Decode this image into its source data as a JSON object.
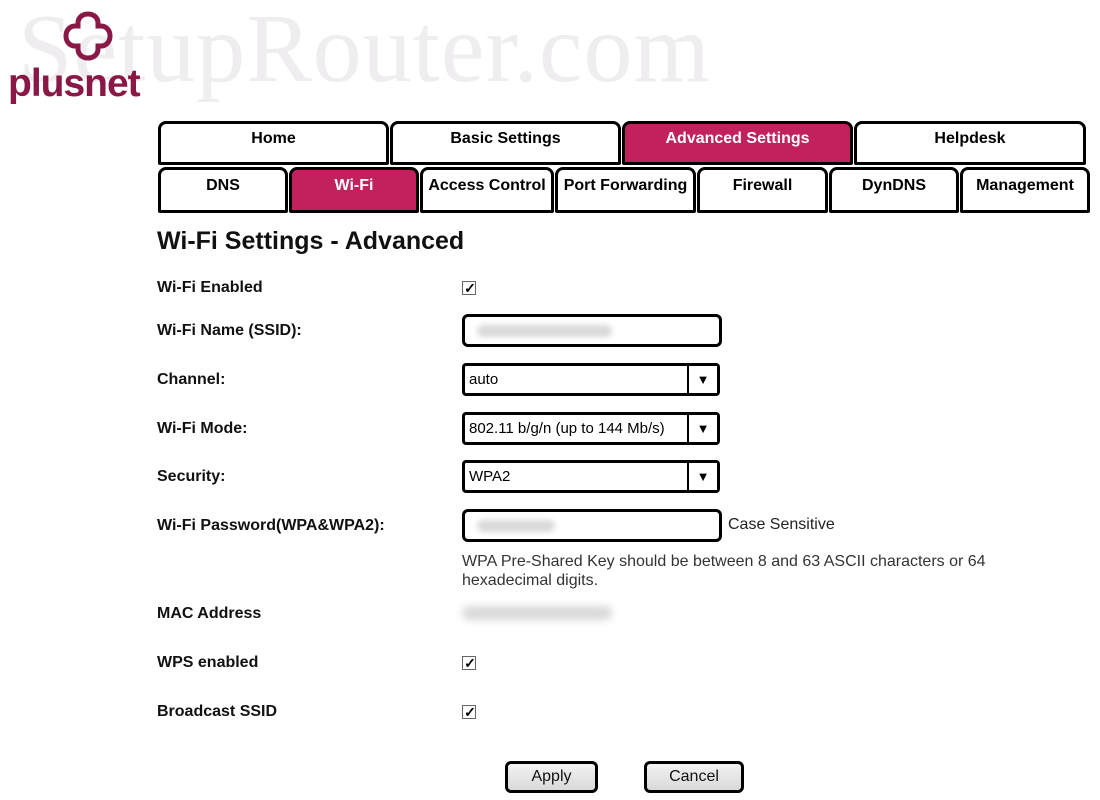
{
  "branding": {
    "logo_text": "plusnet",
    "watermark": "SetupRouter.com",
    "brand_color": "#c1225e",
    "logo_color": "#8a1846"
  },
  "main_tabs": [
    {
      "label": "Home",
      "active": false
    },
    {
      "label": "Basic Settings",
      "active": false
    },
    {
      "label": "Advanced Settings",
      "active": true
    },
    {
      "label": "Helpdesk",
      "active": false
    }
  ],
  "sub_tabs": [
    {
      "label": "DNS",
      "active": false
    },
    {
      "label": "Wi-Fi",
      "active": true
    },
    {
      "label": "Access Control",
      "active": false
    },
    {
      "label": "Port Forwarding",
      "active": false
    },
    {
      "label": "Firewall",
      "active": false
    },
    {
      "label": "DynDNS",
      "active": false
    },
    {
      "label": "Management",
      "active": false
    }
  ],
  "page_title": "Wi-Fi Settings - Advanced",
  "form": {
    "wifi_enabled": {
      "label": "Wi-Fi Enabled",
      "checked": true
    },
    "ssid": {
      "label": "Wi-Fi Name (SSID):",
      "value_redacted": true
    },
    "channel": {
      "label": "Channel:",
      "value": "auto"
    },
    "wifi_mode": {
      "label": "Wi-Fi Mode:",
      "value": "802.11 b/g/n (up to 144 Mb/s)"
    },
    "security": {
      "label": "Security:",
      "value": "WPA2"
    },
    "password": {
      "label": "Wi-Fi Password(WPA&WPA2):",
      "value_redacted": true,
      "note": "Case Sensitive",
      "hint": "WPA Pre-Shared Key should be between 8 and 63 ASCII characters or 64 hexadecimal digits."
    },
    "mac_address": {
      "label": "MAC Address",
      "value_redacted": true
    },
    "wps_enabled": {
      "label": "WPS enabled",
      "checked": true
    },
    "broadcast_ssid": {
      "label": "Broadcast SSID",
      "checked": true
    }
  },
  "buttons": {
    "apply": "Apply",
    "cancel": "Cancel"
  },
  "icons": {
    "checkbox_mark": "✓",
    "dropdown_arrow": "▼"
  }
}
